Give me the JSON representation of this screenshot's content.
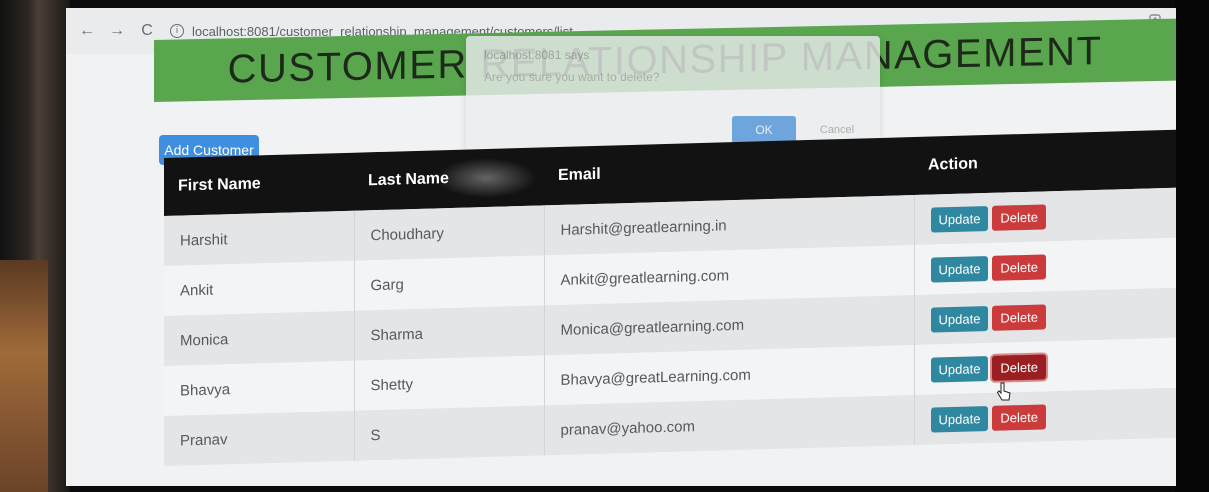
{
  "browser": {
    "back_icon": "←",
    "forward_icon": "→",
    "reload_icon": "C",
    "info_icon": "i",
    "url": "localhost:8081/customer_relationship_management/customers/list"
  },
  "header": {
    "title": "CUSTOMER RELATIONSHIP MANAGEMENT",
    "color": "#5aa64f"
  },
  "dialog": {
    "line1": "localhost:8081 says",
    "line2": "Are you sure you want to delete?",
    "ok_label": "OK",
    "cancel_label": "Cancel"
  },
  "toolbar": {
    "add_label": "Add Customer"
  },
  "table": {
    "headers": [
      "First Name",
      "Last Name",
      "Email",
      "Action"
    ],
    "rows": [
      {
        "first": "Harshit",
        "last": "Choudhary",
        "email": "Harshit@greatlearning.in",
        "update": "Update",
        "delete": "Delete"
      },
      {
        "first": "Ankit",
        "last": "Garg",
        "email": "Ankit@greatlearning.com",
        "update": "Update",
        "delete": "Delete"
      },
      {
        "first": "Monica",
        "last": "Sharma",
        "email": "Monica@greatlearning.com",
        "update": "Update",
        "delete": "Delete"
      },
      {
        "first": "Bhavya",
        "last": "Shetty",
        "email": "Bhavya@greatLearning.com",
        "update": "Update",
        "delete": "Delete"
      },
      {
        "first": "Pranav",
        "last": "S",
        "email": "pranav@yahoo.com",
        "update": "Update",
        "delete": "Delete"
      }
    ]
  },
  "colors": {
    "update_button": "#2f87a0",
    "delete_button": "#cc3b3b",
    "add_button": "#3f8fde",
    "table_header": "#121212"
  }
}
